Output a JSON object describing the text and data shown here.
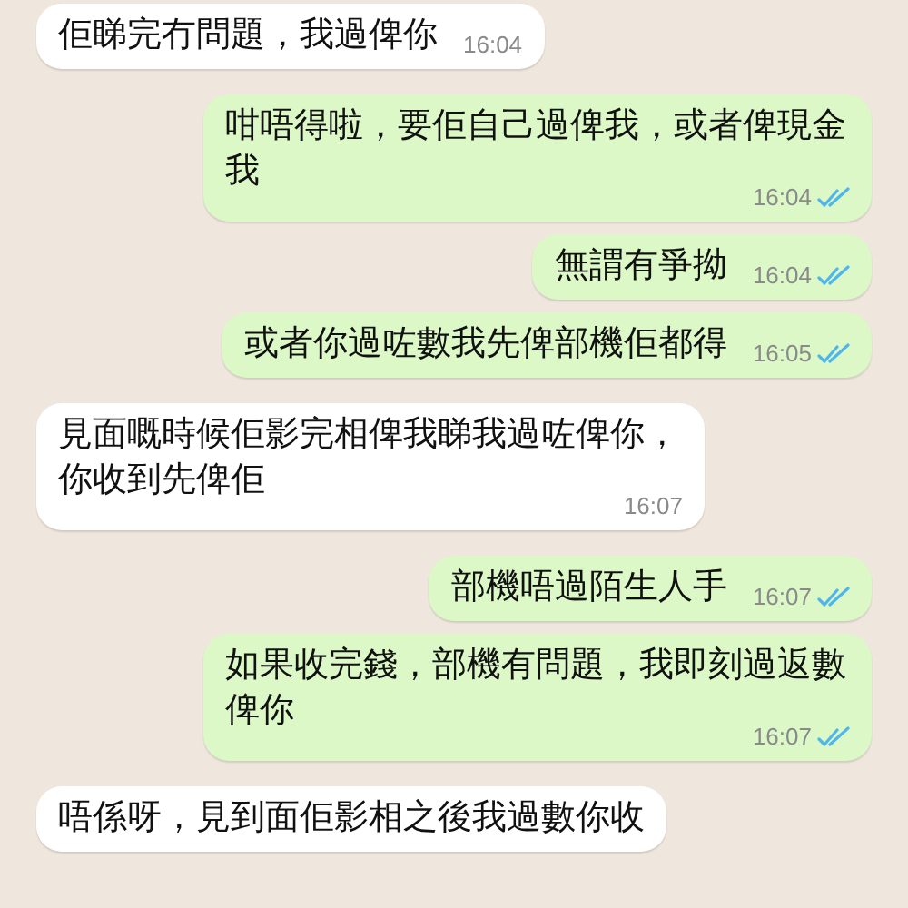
{
  "messages": [
    {
      "kind": "incoming",
      "text": "佢睇完冇問題，我過俾你",
      "time": "16:04"
    },
    {
      "kind": "outgoing",
      "text": "咁唔得啦，要佢自己過俾我，或者俾現金我",
      "time": "16:04",
      "read": true
    },
    {
      "kind": "outgoing",
      "text": "無謂有爭拗",
      "time": "16:04",
      "read": true
    },
    {
      "kind": "outgoing",
      "text": "或者你過咗數我先俾部機佢都得",
      "time": "16:05",
      "read": true
    },
    {
      "kind": "incoming",
      "text": "見面嘅時候佢影完相俾我睇我過咗俾你，你收到先俾佢",
      "time": "16:07"
    },
    {
      "kind": "outgoing",
      "text": "部機唔過陌生人手",
      "time": "16:07",
      "read": true
    },
    {
      "kind": "outgoing",
      "text": "如果收完錢，部機有問題，我即刻過返數俾你",
      "time": "16:07",
      "read": true
    },
    {
      "kind": "incoming",
      "text": "唔係呀，見到面佢影相之後我過數你收"
    }
  ]
}
